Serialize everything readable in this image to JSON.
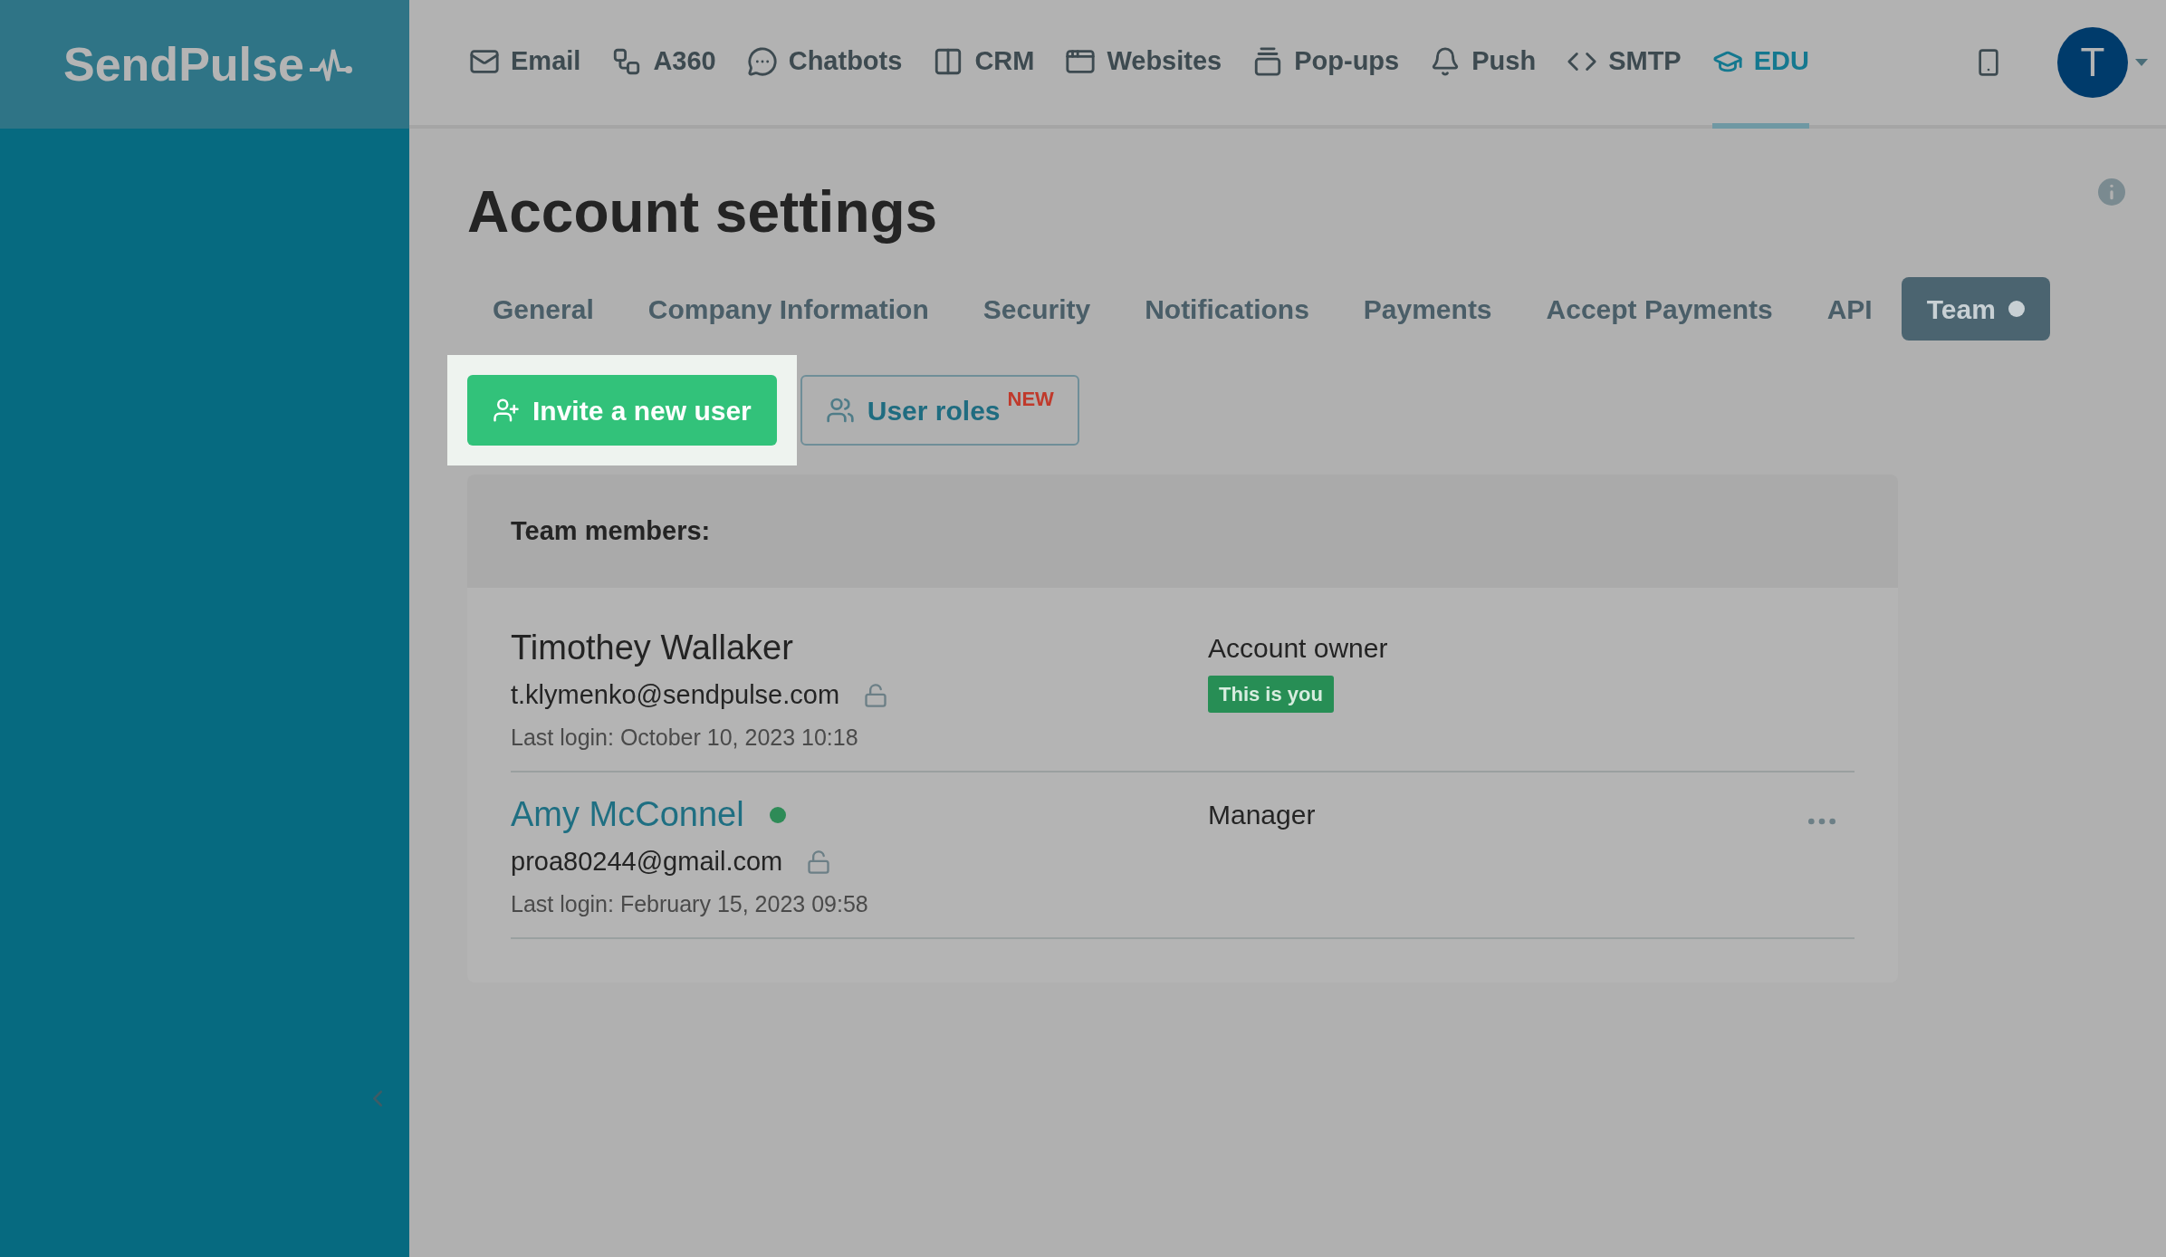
{
  "logo": "SendPulse",
  "nav": [
    {
      "label": "Email",
      "selected": false
    },
    {
      "label": "A360",
      "selected": false
    },
    {
      "label": "Chatbots",
      "selected": false
    },
    {
      "label": "CRM",
      "selected": false
    },
    {
      "label": "Websites",
      "selected": false
    },
    {
      "label": "Pop-ups",
      "selected": false
    },
    {
      "label": "Push",
      "selected": false
    },
    {
      "label": "SMTP",
      "selected": false
    },
    {
      "label": "EDU",
      "selected": true
    }
  ],
  "avatar": "T",
  "title": "Account settings",
  "tabs": [
    {
      "label": "General",
      "selected": false,
      "dot": false
    },
    {
      "label": "Company Information",
      "selected": false,
      "dot": false
    },
    {
      "label": "Security",
      "selected": false,
      "dot": false
    },
    {
      "label": "Notifications",
      "selected": false,
      "dot": false
    },
    {
      "label": "Payments",
      "selected": false,
      "dot": false
    },
    {
      "label": "Accept Payments",
      "selected": false,
      "dot": false
    },
    {
      "label": "API",
      "selected": false,
      "dot": false
    },
    {
      "label": "Team",
      "selected": true,
      "dot": true
    }
  ],
  "invite_button": "Invite a new user",
  "roles_button": {
    "label": "User roles",
    "badge": "NEW"
  },
  "team": {
    "heading": "Team members:",
    "members": [
      {
        "name": "Timothey Wallaker",
        "link": false,
        "online": false,
        "email": "t.klymenko@sendpulse.com",
        "last_login": "Last login: October 10, 2023 10:18",
        "role": "Account owner",
        "badge": "This is you",
        "menu": false
      },
      {
        "name": "Amy McConnel",
        "link": true,
        "online": true,
        "email": "proa80244@gmail.com",
        "last_login": "Last login: February 15, 2023 09:58",
        "role": "Manager",
        "menu": true
      }
    ]
  }
}
